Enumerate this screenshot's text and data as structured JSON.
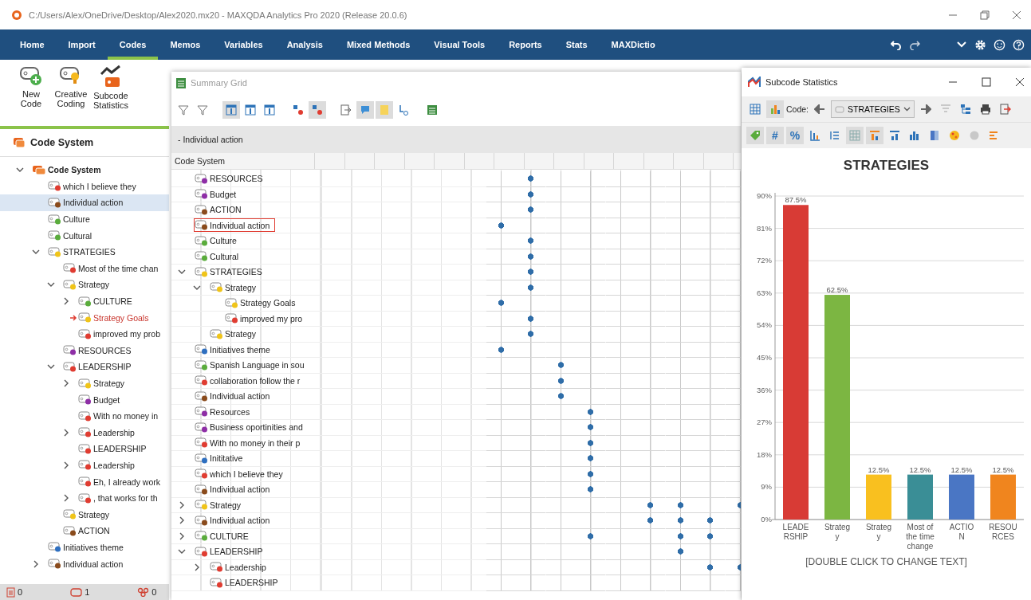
{
  "window": {
    "title": "C:/Users/Alex/OneDrive/Desktop/Alex2020.mx20 - MAXQDA Analytics Pro 2020 (Release 20.0.6)"
  },
  "menu": [
    {
      "label": "Home",
      "selected": false
    },
    {
      "label": "Import",
      "selected": false
    },
    {
      "label": "Codes",
      "selected": true
    },
    {
      "label": "Memos",
      "selected": false
    },
    {
      "label": "Variables",
      "selected": false
    },
    {
      "label": "Analysis",
      "selected": false
    },
    {
      "label": "Mixed Methods",
      "selected": false
    },
    {
      "label": "Visual Tools",
      "selected": false
    },
    {
      "label": "Reports",
      "selected": false
    },
    {
      "label": "Stats",
      "selected": false
    },
    {
      "label": "MAXDictio",
      "selected": false
    }
  ],
  "ribbon": [
    {
      "kind": "new",
      "label": "New Code"
    },
    {
      "kind": "creative",
      "label": "Creative Coding"
    },
    {
      "kind": "stats",
      "label": "Subcode Statistics"
    }
  ],
  "code_system": {
    "title": "Code System",
    "root": {
      "label": "Code System",
      "expanded": true
    },
    "items": [
      {
        "label": "which I believe they",
        "color": "#e03c31",
        "selected": false,
        "activated": false
      },
      {
        "label": "Individual action",
        "color": "#8a4b1c",
        "selected": true,
        "activated": false
      },
      {
        "label": "Culture",
        "color": "#5aac3c",
        "selected": false,
        "activated": false
      },
      {
        "label": "Cultural",
        "color": "#5aac3c",
        "selected": false,
        "activated": false
      },
      {
        "label": "STRATEGIES",
        "color": "#f0c419",
        "selected": false,
        "activated": false,
        "expanded": true,
        "children": [
          {
            "label": "Most of the time chan",
            "color": "#e03c31",
            "selected": false,
            "activated": false
          },
          {
            "label": "Strategy",
            "color": "#f0c419",
            "selected": false,
            "activated": false,
            "expanded": true,
            "children": [
              {
                "label": "CULTURE",
                "color": "#5aac3c",
                "selected": false,
                "activated": false,
                "expanded": false
              },
              {
                "label": "Strategy  Goals",
                "color": "#f0c419",
                "selected": false,
                "activated": true
              },
              {
                "label": "improved my prob",
                "color": "#e03c31",
                "selected": false,
                "activated": false
              }
            ]
          },
          {
            "label": "RESOURCES",
            "color": "#8e2ea6",
            "selected": false,
            "activated": false
          },
          {
            "label": "LEADERSHIP",
            "color": "#e03c31",
            "selected": false,
            "activated": false,
            "expanded": true,
            "children": [
              {
                "label": "Strategy",
                "color": "#f0c419",
                "selected": false,
                "activated": false,
                "expanded": false
              },
              {
                "label": "Budget",
                "color": "#8e2ea6",
                "selected": false,
                "activated": false
              },
              {
                "label": "With no money in",
                "color": "#e03c31",
                "selected": false,
                "activated": false
              },
              {
                "label": "Leadership",
                "color": "#e03c31",
                "selected": false,
                "activated": false,
                "expanded": false
              },
              {
                "label": "LEADERSHIP",
                "color": "#e03c31",
                "selected": false,
                "activated": false
              },
              {
                "label": "Leadership",
                "color": "#e03c31",
                "selected": false,
                "activated": false,
                "expanded": false
              },
              {
                "label": "Eh, I already work",
                "color": "#e03c31",
                "selected": false,
                "activated": false
              },
              {
                "label": ", that works for th",
                "color": "#e03c31",
                "selected": false,
                "activated": false,
                "expanded": false
              }
            ]
          },
          {
            "label": "Strategy",
            "color": "#f0c419",
            "selected": false,
            "activated": false
          },
          {
            "label": "ACTION",
            "color": "#8a4b1c",
            "selected": false,
            "activated": false
          }
        ]
      },
      {
        "label": "Initiatives theme",
        "color": "#2e6fc0",
        "selected": false,
        "activated": false
      },
      {
        "label": "Individual action",
        "color": "#8a4b1c",
        "selected": false,
        "activated": false,
        "expanded": false
      }
    ]
  },
  "status_counts": [
    {
      "kind": "documents",
      "count": "0"
    },
    {
      "kind": "codes",
      "count": "1"
    },
    {
      "kind": "memos",
      "count": "0"
    }
  ],
  "summary_grid": {
    "title": "Summary Grid",
    "breadcrumb": "- Individual action",
    "column_header": "Code System",
    "rows": [
      {
        "label": "RESOURCES",
        "color": "#8e2ea6",
        "selected": false,
        "dots": [
          false,
          true,
          false,
          false,
          false,
          false,
          false,
          false,
          false
        ]
      },
      {
        "label": "Budget",
        "color": "#8e2ea6",
        "selected": false,
        "dots": [
          false,
          true,
          false,
          false,
          false,
          false,
          false,
          false,
          false
        ]
      },
      {
        "label": "ACTION",
        "color": "#8a4b1c",
        "selected": false,
        "dots": [
          false,
          true,
          false,
          false,
          false,
          false,
          false,
          false,
          false
        ]
      },
      {
        "label": "Individual action",
        "color": "#8a4b1c",
        "selected": true,
        "dots": [
          true,
          false,
          false,
          false,
          false,
          false,
          false,
          false,
          false
        ]
      },
      {
        "label": "Culture",
        "color": "#5aac3c",
        "selected": false,
        "dots": [
          false,
          true,
          false,
          false,
          false,
          false,
          false,
          false,
          false
        ]
      },
      {
        "label": "Cultural",
        "color": "#5aac3c",
        "selected": false,
        "dots": [
          false,
          true,
          false,
          false,
          false,
          false,
          false,
          false,
          false
        ]
      },
      {
        "label": "STRATEGIES",
        "color": "#f0c419",
        "selected": false,
        "expanded": true,
        "dots": [
          false,
          true,
          false,
          false,
          false,
          false,
          false,
          false,
          false
        ],
        "children": [
          {
            "label": "Strategy",
            "color": "#f0c419",
            "selected": false,
            "expanded": true,
            "dots": [
              false,
              true,
              false,
              false,
              false,
              false,
              false,
              false,
              false
            ],
            "children": [
              {
                "label": "Strategy  Goals",
                "color": "#f0c419",
                "selected": false,
                "dots": [
                  true,
                  false,
                  false,
                  false,
                  false,
                  false,
                  false,
                  false,
                  false
                ]
              },
              {
                "label": "improved my pro",
                "color": "#e03c31",
                "selected": false,
                "dots": [
                  false,
                  true,
                  false,
                  false,
                  false,
                  false,
                  false,
                  false,
                  false
                ]
              }
            ]
          },
          {
            "label": "Strategy",
            "color": "#f0c419",
            "selected": false,
            "dots": [
              false,
              true,
              false,
              false,
              false,
              false,
              false,
              false,
              false
            ]
          }
        ]
      },
      {
        "label": "Initiatives theme",
        "color": "#2e6fc0",
        "selected": false,
        "dots": [
          true,
          false,
          false,
          false,
          false,
          false,
          false,
          false,
          false
        ]
      },
      {
        "label": "Spanish Language in sou",
        "color": "#5aac3c",
        "selected": false,
        "dots": [
          false,
          false,
          true,
          false,
          false,
          false,
          false,
          false,
          false
        ]
      },
      {
        "label": "collaboration follow the r",
        "color": "#e03c31",
        "selected": false,
        "dots": [
          false,
          false,
          true,
          false,
          false,
          false,
          false,
          false,
          false
        ]
      },
      {
        "label": "Individual action",
        "color": "#8a4b1c",
        "selected": false,
        "dots": [
          false,
          false,
          true,
          false,
          false,
          false,
          false,
          false,
          false
        ]
      },
      {
        "label": "Resources",
        "color": "#8e2ea6",
        "selected": false,
        "dots": [
          false,
          false,
          false,
          true,
          false,
          false,
          false,
          false,
          false
        ]
      },
      {
        "label": "Business oportinities and",
        "color": "#8e2ea6",
        "selected": false,
        "dots": [
          false,
          false,
          false,
          true,
          false,
          false,
          false,
          false,
          false
        ]
      },
      {
        "label": "With no money in their p",
        "color": "#e03c31",
        "selected": false,
        "dots": [
          false,
          false,
          false,
          true,
          false,
          false,
          false,
          false,
          false
        ]
      },
      {
        "label": "Inititative",
        "color": "#2e6fc0",
        "selected": false,
        "dots": [
          false,
          false,
          false,
          true,
          false,
          false,
          false,
          false,
          false
        ]
      },
      {
        "label": "which I believe they",
        "color": "#e03c31",
        "selected": false,
        "dots": [
          false,
          false,
          false,
          true,
          false,
          false,
          false,
          false,
          false
        ]
      },
      {
        "label": "Individual action",
        "color": "#8a4b1c",
        "selected": false,
        "dots": [
          false,
          false,
          false,
          true,
          false,
          false,
          false,
          false,
          false
        ]
      },
      {
        "label": "Strategy",
        "color": "#f0c419",
        "selected": false,
        "expanded": false,
        "dots": [
          false,
          false,
          false,
          false,
          false,
          true,
          true,
          false,
          true
        ]
      },
      {
        "label": "Individual action",
        "color": "#8a4b1c",
        "selected": false,
        "expanded": false,
        "dots": [
          false,
          false,
          false,
          false,
          false,
          true,
          true,
          true,
          false
        ]
      },
      {
        "label": "CULTURE",
        "color": "#5aac3c",
        "selected": false,
        "expanded": false,
        "dots": [
          false,
          false,
          false,
          true,
          false,
          false,
          true,
          true,
          false
        ]
      },
      {
        "label": "LEADERSHIP",
        "color": "#e03c31",
        "selected": false,
        "expanded": true,
        "dots": [
          false,
          false,
          false,
          false,
          false,
          false,
          true,
          false,
          false
        ],
        "children": [
          {
            "label": "Leadership",
            "color": "#e03c31",
            "selected": false,
            "expanded": false,
            "dots": [
              false,
              false,
              false,
              false,
              false,
              false,
              false,
              true,
              true
            ]
          },
          {
            "label": "LEADERSHIP",
            "color": "#e03c31",
            "selected": false,
            "dots": [
              false,
              false,
              false,
              false,
              false,
              false,
              false,
              false,
              false
            ]
          }
        ]
      }
    ]
  },
  "subcode_statistics": {
    "title": "Subcode Statistics",
    "code_label": "Code:",
    "code_value": "STRATEGIES",
    "toolbar_symbols": [
      "#",
      "%"
    ],
    "chart_data": {
      "type": "bar",
      "title": "STRATEGIES",
      "categories": [
        "LEADERSHIP",
        "Strategy",
        "Strategy",
        "Most of the time change",
        "ACTION",
        "RESOURCES"
      ],
      "values": [
        87.5,
        62.5,
        12.5,
        12.5,
        12.5,
        12.5
      ],
      "colors": [
        "#d83b35",
        "#7cb642",
        "#f9c01f",
        "#3a8e96",
        "#4a76c4",
        "#f0851e"
      ],
      "value_labels": [
        "87.5%",
        "62.5%",
        "12.5%",
        "12.5%",
        "12.5%",
        "12.5%"
      ],
      "ylim": [
        0,
        90
      ],
      "grid": true,
      "yticks": [
        {
          "value": 0,
          "label": "0%"
        },
        {
          "value": 9,
          "label": "9%"
        },
        {
          "value": 18,
          "label": "18%"
        },
        {
          "value": 27,
          "label": "27%"
        },
        {
          "value": 36,
          "label": "36%"
        },
        {
          "value": 45,
          "label": "45%"
        },
        {
          "value": 54,
          "label": "54%"
        },
        {
          "value": 63,
          "label": "63%"
        },
        {
          "value": 72,
          "label": "72%"
        },
        {
          "value": 81,
          "label": "81%"
        },
        {
          "value": 90,
          "label": "90%"
        }
      ]
    },
    "footer": "[DOUBLE CLICK TO CHANGE TEXT]"
  }
}
